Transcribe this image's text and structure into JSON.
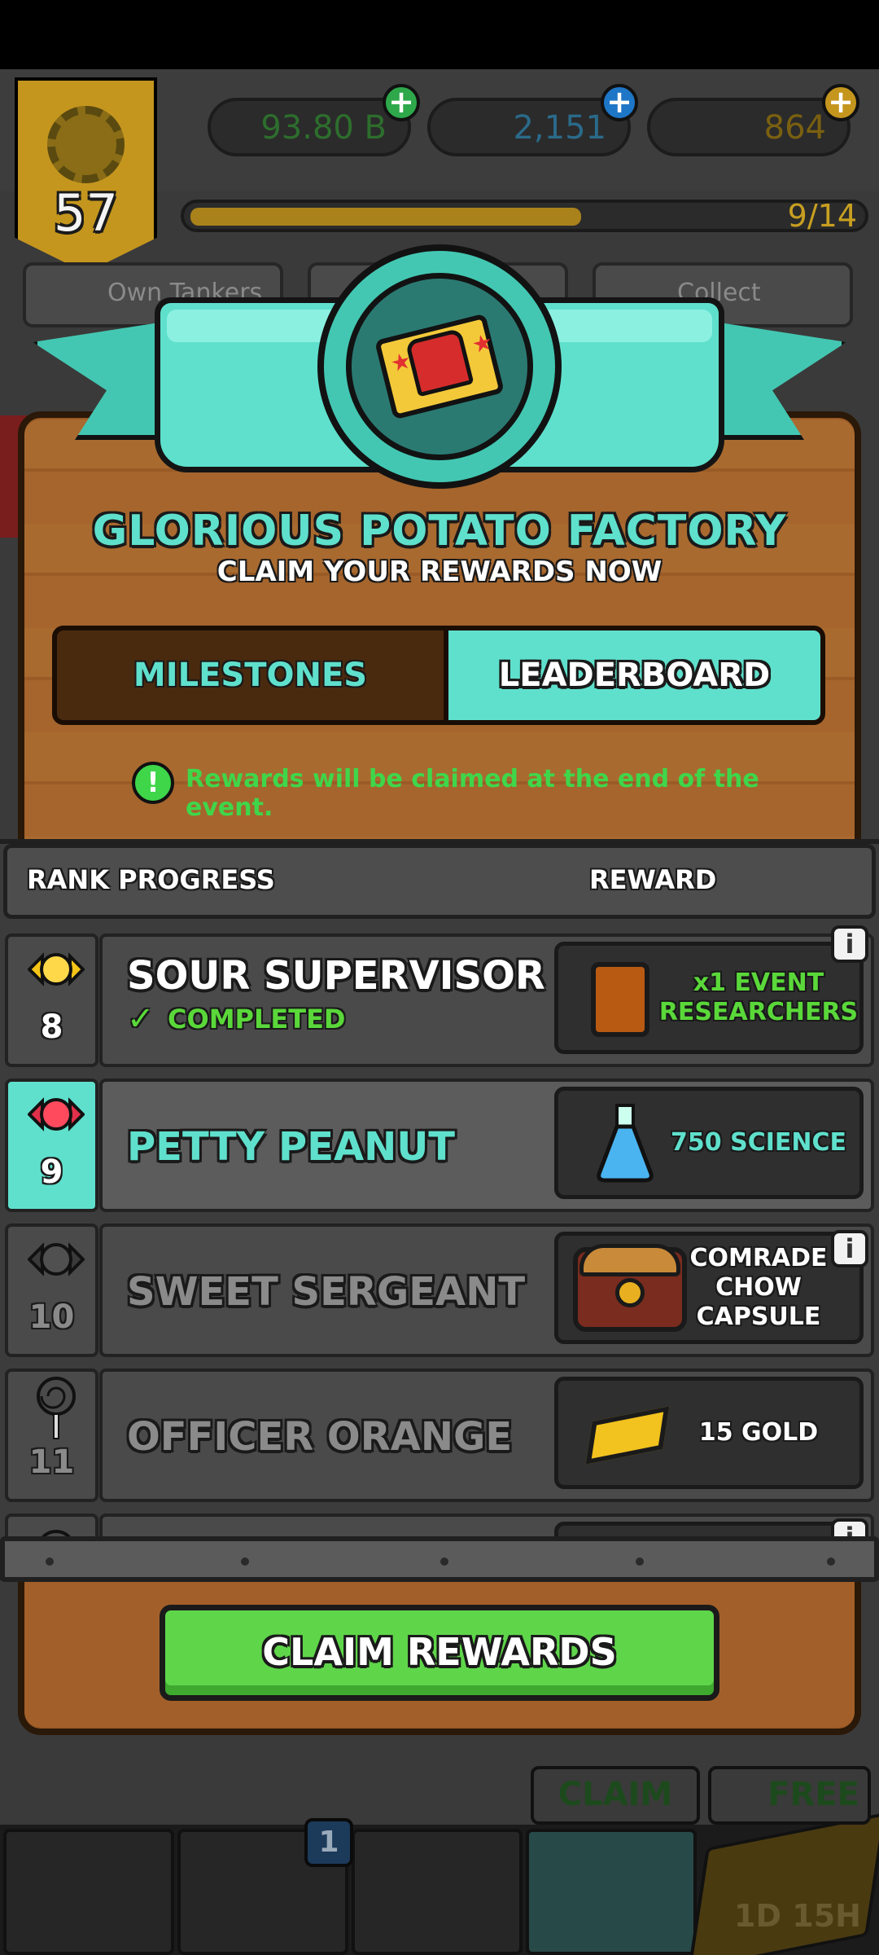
{
  "hud": {
    "level": "57",
    "cash": "93.80 B",
    "science": "2,151",
    "gold": "864",
    "xp_text": "9/14",
    "chips": [
      "Own Tankers",
      "Collect"
    ]
  },
  "event": {
    "title": "GLORIOUS POTATO FACTORY",
    "subtitle": "CLAIM YOUR REWARDS NOW"
  },
  "tabs": {
    "milestones": "MILESTONES",
    "leaderboard": "LEADERBOARD",
    "active": "leaderboard"
  },
  "notice": {
    "icon": "!",
    "text": "Rewards will be claimed at the end of the event."
  },
  "table": {
    "col_rank": "RANK PROGRESS",
    "col_reward": "REWARD",
    "rows": [
      {
        "rank": "8",
        "name": "SOUR SUPERVISOR",
        "status": "COMPLETED",
        "reward": "x1 EVENT RESEARCHERS",
        "reward_icon": "book-icon",
        "info": "i"
      },
      {
        "rank": "9",
        "name": "PETTY PEANUT",
        "status": "",
        "reward": "750 SCIENCE",
        "reward_icon": "flask-icon",
        "info": ""
      },
      {
        "rank": "10",
        "name": "SWEET SERGEANT",
        "status": "",
        "reward": "COMRADE CHOW CAPSULE",
        "reward_icon": "chest-icon",
        "info": "i"
      },
      {
        "rank": "11",
        "name": "OFFICER ORANGE",
        "status": "",
        "reward": "15 GOLD",
        "reward_icon": "gold-bar-icon",
        "info": ""
      },
      {
        "rank": "",
        "name": "",
        "status": "",
        "reward": "",
        "reward_icon": "",
        "info": "i"
      }
    ]
  },
  "claim_button": "CLAIM REWARDS",
  "bottom_nav": {
    "badge": "1",
    "claim": "CLAIM",
    "free": "FREE",
    "timer": "1D 15H"
  },
  "colors": {
    "accent": "#5fe0cc",
    "wood": "#9b5a25",
    "green": "#5fd64a"
  }
}
